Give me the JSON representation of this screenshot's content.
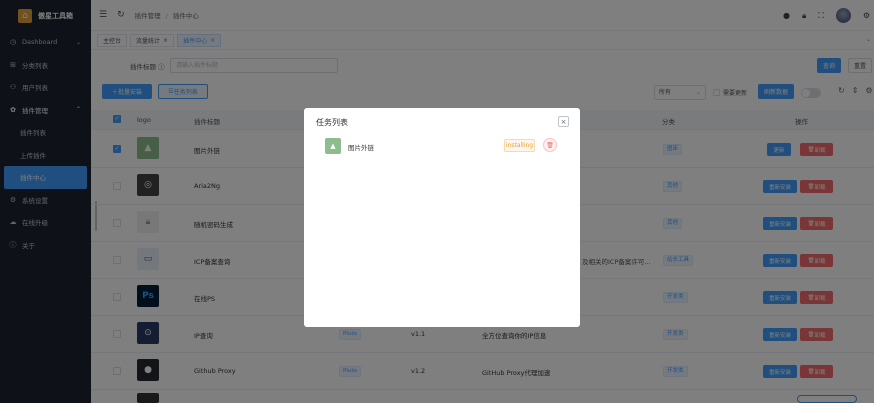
{
  "app": {
    "name": "傲星工具箱"
  },
  "sidebar": {
    "items": [
      {
        "label": "Dashboard",
        "icon": "clock-icon"
      },
      {
        "label": "分类列表",
        "icon": "building-icon"
      },
      {
        "label": "用户列表",
        "icon": "users-icon"
      },
      {
        "label": "插件管理",
        "icon": "gear-icon"
      },
      {
        "label": "插件列表"
      },
      {
        "label": "上传插件"
      },
      {
        "label": "插件中心"
      },
      {
        "label": "系统设置",
        "icon": "settings-icon"
      },
      {
        "label": "在线升级",
        "icon": "cloud-icon"
      },
      {
        "label": "关于",
        "icon": "info-icon"
      }
    ]
  },
  "breadcrumb": {
    "parent": "插件管理",
    "current": "插件中心",
    "sep": "/"
  },
  "tabs": [
    {
      "label": "主控台"
    },
    {
      "label": "流量统计"
    },
    {
      "label": "插件中心"
    }
  ],
  "search": {
    "label": "插件标题",
    "placeholder": "请输入插件标题",
    "query_label": "查询",
    "reset_label": "重置"
  },
  "toolbar": {
    "batch_label": "批量安装",
    "tasks_label": "任务列表",
    "filter_value": "所有",
    "update_label": "需要更新",
    "refresh_label": "刷新数据"
  },
  "table": {
    "headers": {
      "logo": "logo",
      "title": "插件标题",
      "category": "分类",
      "actions": "操作"
    },
    "rows": [
      {
        "title": "图片外链",
        "category": "图床",
        "checked": true,
        "btn1": "更新",
        "btn2": "卸载"
      },
      {
        "title": "Aria2Ng",
        "category": "其他",
        "checked": false,
        "btn1": "重新安装",
        "btn2": "卸载"
      },
      {
        "title": "随机密码生成",
        "category": "其他",
        "checked": false,
        "btn1": "重新安装",
        "btn2": "卸载"
      },
      {
        "title": "ICP备案查询",
        "category": "站长工具",
        "desc": "及相关的ICP备案许可...",
        "checked": false,
        "btn1": "重新安装",
        "btn2": "卸载"
      },
      {
        "title": "在线PS",
        "category": "开发类",
        "checked": false,
        "btn1": "重新安装",
        "btn2": "卸载"
      },
      {
        "title": "IP查询",
        "category": "开发类",
        "author": "Pluto",
        "version": "v1.1",
        "desc": "全方位查询你的IP信息",
        "checked": false,
        "btn1": "重新安装",
        "btn2": "卸载"
      },
      {
        "title": "Github Proxy",
        "category": "开发类",
        "author": "Pluto",
        "version": "v1.2",
        "desc": "GitHub Proxy代理加速",
        "checked": false,
        "btn1": "重新安装",
        "btn2": "卸载"
      }
    ]
  },
  "modal": {
    "title": "任务列表",
    "task": {
      "name": "图片外链",
      "status": "installing"
    }
  }
}
